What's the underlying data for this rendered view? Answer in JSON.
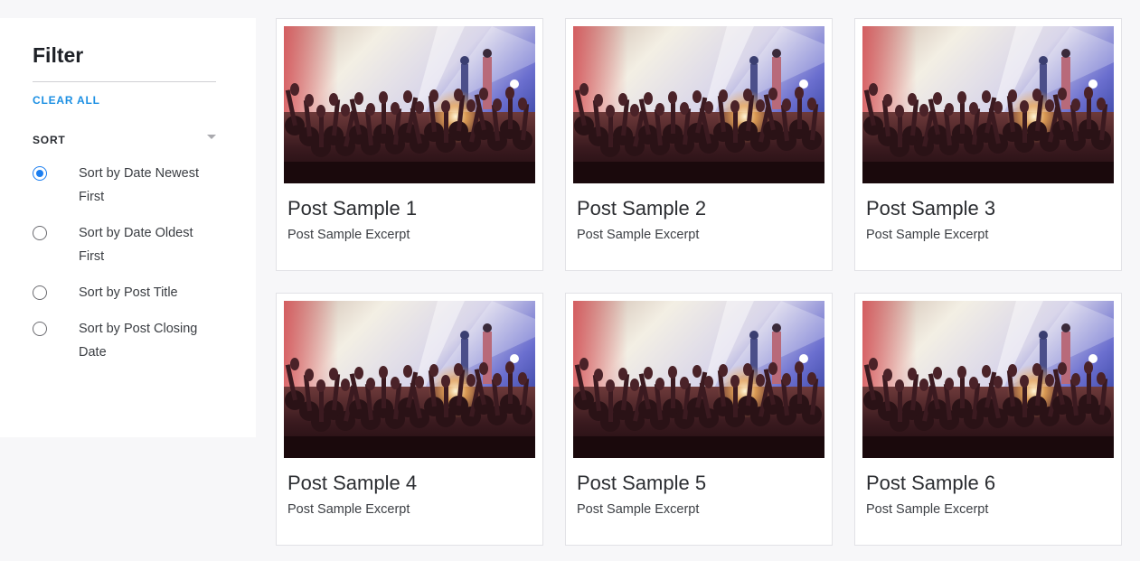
{
  "sidebar": {
    "title": "Filter",
    "clear_all": "CLEAR ALL",
    "sort_label": "SORT",
    "sort_options": [
      {
        "label": "Sort by Date Newest First",
        "selected": true
      },
      {
        "label": "Sort by Date Oldest First",
        "selected": false
      },
      {
        "label": "Sort by Post Title",
        "selected": false
      },
      {
        "label": "Sort by Post Closing Date",
        "selected": false
      }
    ]
  },
  "posts": [
    {
      "title": "Post Sample 1",
      "excerpt": "Post Sample Excerpt",
      "image": "concert-crowd-photo"
    },
    {
      "title": "Post Sample 2",
      "excerpt": "Post Sample Excerpt",
      "image": "concert-crowd-photo"
    },
    {
      "title": "Post Sample 3",
      "excerpt": "Post Sample Excerpt",
      "image": "concert-crowd-photo"
    },
    {
      "title": "Post Sample 4",
      "excerpt": "Post Sample Excerpt",
      "image": "concert-crowd-photo"
    },
    {
      "title": "Post Sample 5",
      "excerpt": "Post Sample Excerpt",
      "image": "concert-crowd-photo"
    },
    {
      "title": "Post Sample 6",
      "excerpt": "Post Sample Excerpt",
      "image": "concert-crowd-photo"
    }
  ],
  "colors": {
    "accent": "#1b8fe3",
    "radio_selected": "#1b7ef0",
    "page_background": "#f7f7f9"
  }
}
